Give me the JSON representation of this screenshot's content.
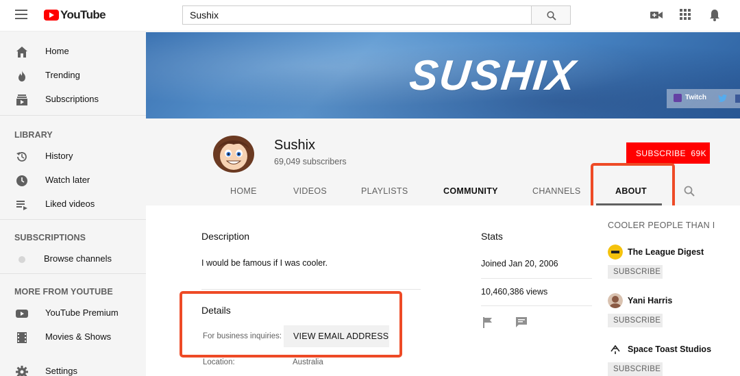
{
  "header": {
    "logo_text": "YouTube",
    "search_value": "Sushix"
  },
  "sidebar": {
    "main": [
      {
        "label": "Home",
        "icon": "home-icon"
      },
      {
        "label": "Trending",
        "icon": "flame-icon"
      },
      {
        "label": "Subscriptions",
        "icon": "subscriptions-icon"
      }
    ],
    "library_heading": "LIBRARY",
    "library": [
      {
        "label": "History",
        "icon": "history-icon"
      },
      {
        "label": "Watch later",
        "icon": "clock-icon"
      },
      {
        "label": "Liked videos",
        "icon": "playlist-icon"
      }
    ],
    "subscriptions_heading": "SUBSCRIPTIONS",
    "subscriptions": [
      {
        "label": "Browse channels",
        "icon": "dot-icon"
      }
    ],
    "more_heading": "MORE FROM YOUTUBE",
    "more": [
      {
        "label": "YouTube Premium",
        "icon": "youtube-icon"
      },
      {
        "label": "Movies & Shows",
        "icon": "film-icon"
      },
      {
        "label": "Settings",
        "icon": "gear-icon"
      }
    ]
  },
  "banner": {
    "title": "SUSHIX",
    "link_label": "Twitch"
  },
  "channel": {
    "name": "Sushix",
    "subscribers": "69,049 subscribers",
    "subscribe_label": "SUBSCRIBE",
    "subscribe_count": "69K",
    "tabs": [
      "HOME",
      "VIDEOS",
      "PLAYLISTS",
      "COMMUNITY",
      "CHANNELS",
      "ABOUT"
    ],
    "active_tab": "ABOUT"
  },
  "about": {
    "description_heading": "Description",
    "description_text": "I would be famous if I was cooler.",
    "details_heading": "Details",
    "business_label": "For business inquiries:",
    "email_button": "VIEW EMAIL ADDRESS",
    "location_label": "Location:",
    "location_value": "Australia",
    "stats_heading": "Stats",
    "joined": "Joined Jan 20, 2006",
    "views": "10,460,386 views"
  },
  "related": {
    "heading": "COOLER PEOPLE THAN I",
    "channels": [
      {
        "name": "The League Digest",
        "subscribe_label": "SUBSCRIBE",
        "color": "#f4c20d"
      },
      {
        "name": "Yani Harris",
        "subscribe_label": "SUBSCRIBE",
        "color": "#8a5a44"
      },
      {
        "name": "Space Toast Studios",
        "subscribe_label": "SUBSCRIBE",
        "color": "#ffffff"
      }
    ]
  },
  "colors": {
    "accent": "#ff0000",
    "highlight": "#ee4a26"
  }
}
